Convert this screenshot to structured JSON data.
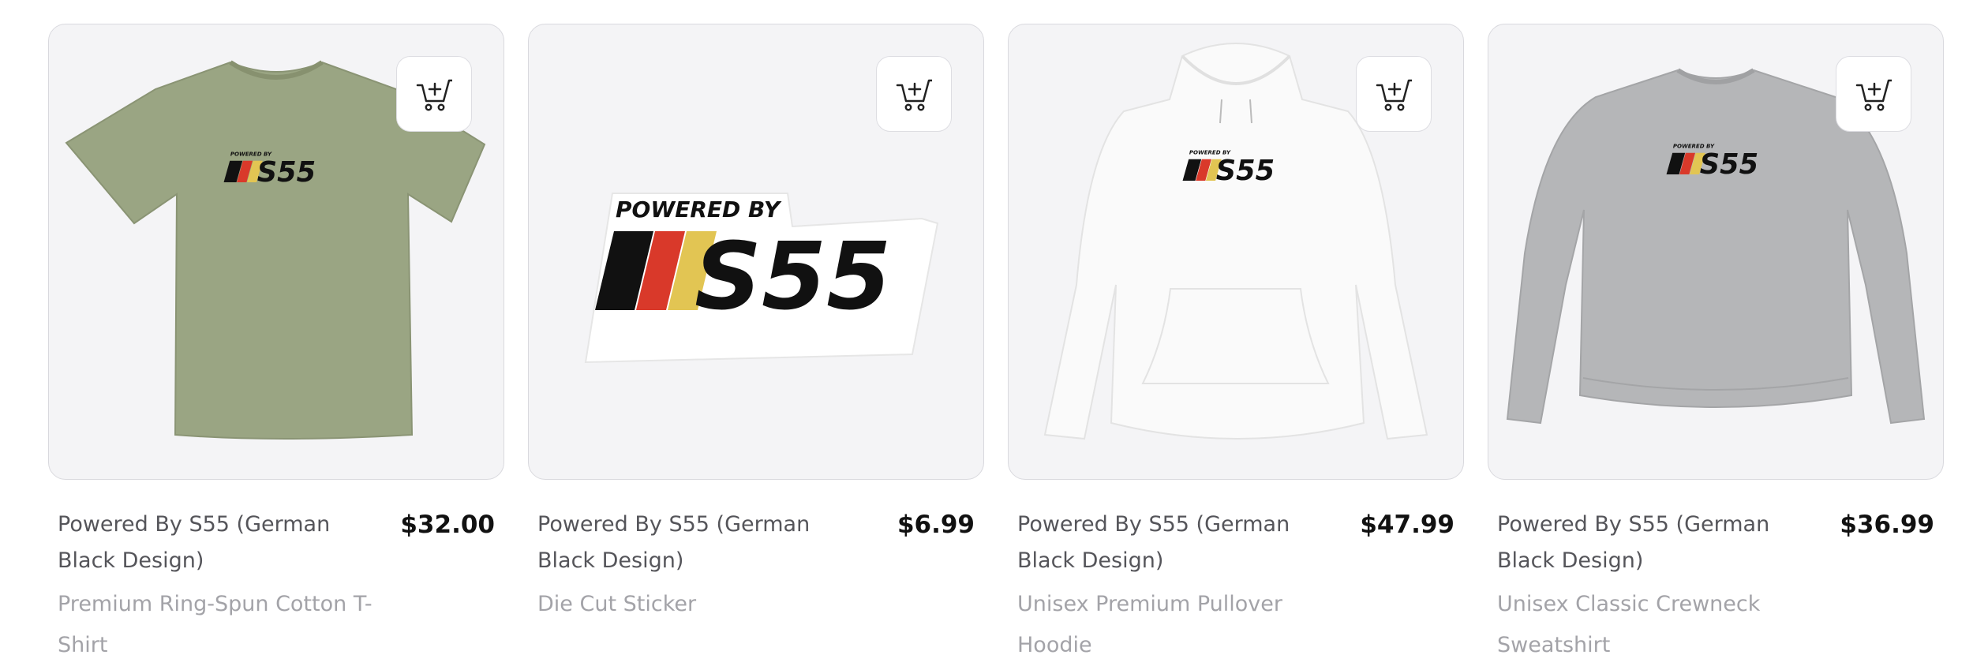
{
  "products": [
    {
      "title": "Powered By S55 (German Black Design)",
      "price": "$32.00",
      "subtitle": "Premium Ring-Spun Cotton T-Shirt",
      "garment_color": "#9aa583",
      "logo": {
        "tagline": "POWERED BY",
        "model": "S55"
      }
    },
    {
      "title": "Powered By S55 (German Black Design)",
      "price": "$6.99",
      "subtitle": "Die Cut Sticker",
      "garment_color": "#ffffff",
      "logo": {
        "tagline": "POWERED BY",
        "model": "S55"
      }
    },
    {
      "title": "Powered By S55 (German Black Design)",
      "price": "$47.99",
      "subtitle": "Unisex Premium Pullover Hoodie",
      "garment_color": "#fafafa",
      "logo": {
        "tagline": "POWERED BY",
        "model": "S55"
      }
    },
    {
      "title": "Powered By S55 (German Black Design)",
      "price": "$36.99",
      "subtitle": "Unisex Classic Crewneck Sweatshirt",
      "garment_color": "#b5b6b8",
      "logo": {
        "tagline": "POWERED BY",
        "model": "S55"
      }
    }
  ],
  "icons": {
    "add_to_cart": "cart-plus-icon"
  },
  "colors": {
    "stripe_black": "#111111",
    "stripe_red": "#d9392a",
    "stripe_gold": "#e2c553"
  }
}
